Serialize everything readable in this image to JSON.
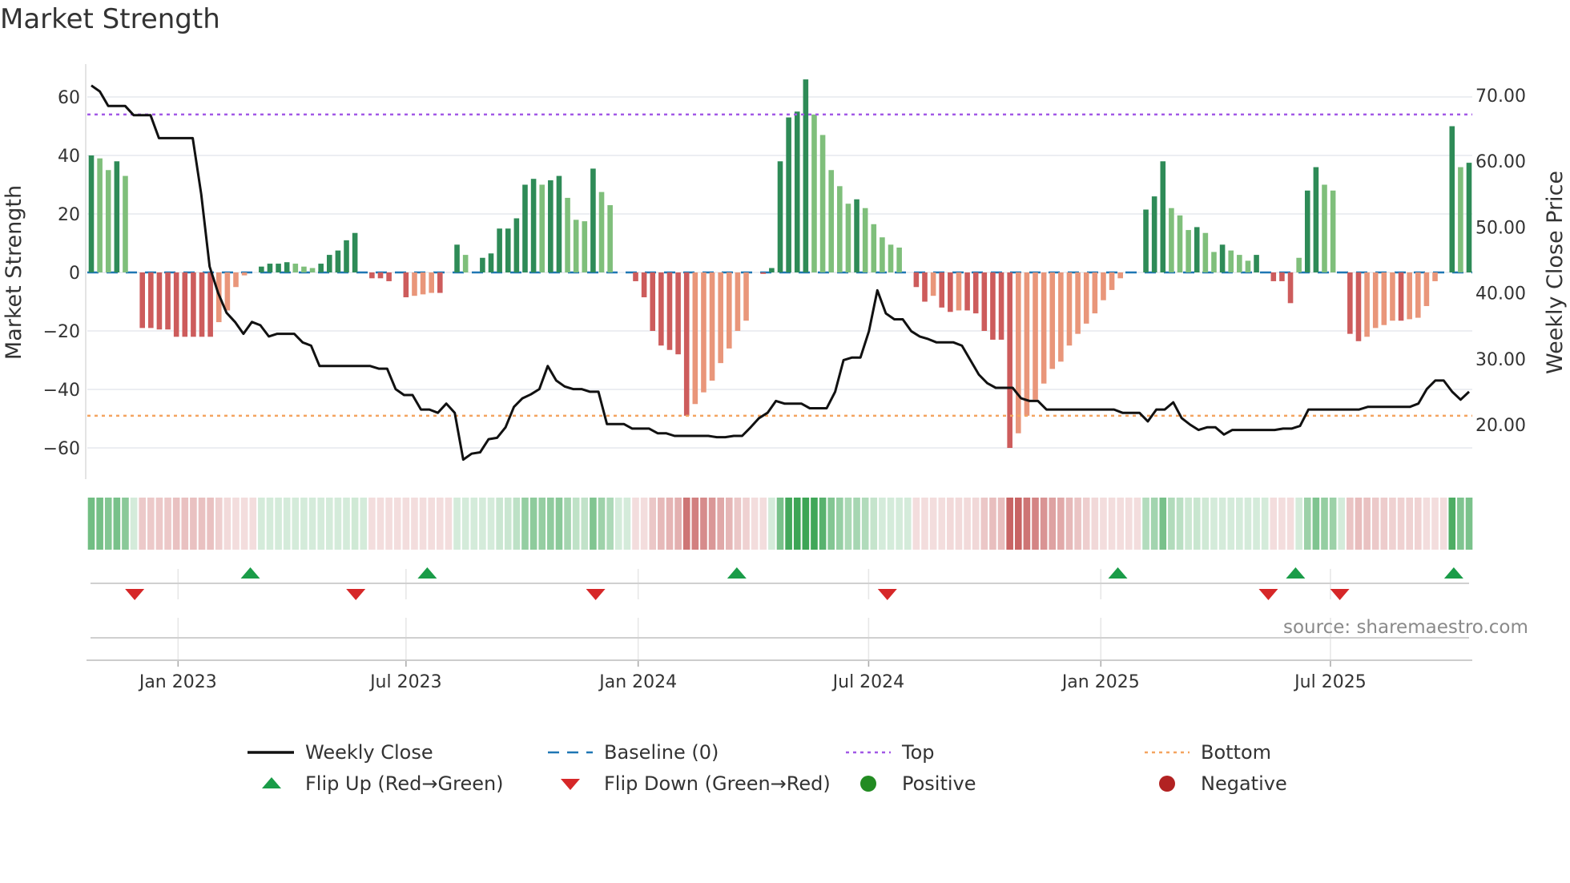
{
  "title": "Market Strength",
  "source": "source: sharemaestro.com",
  "chart_data": {
    "type": "bar",
    "title": "Market Strength",
    "ylabel": "Market Strength",
    "y2label": "Weekly Close Price",
    "ylim": [
      -72,
      70
    ],
    "y2lim": [
      14,
      72
    ],
    "yticks": [
      "60",
      "40",
      "20",
      "0",
      "−20",
      "−40",
      "−60"
    ],
    "ytick_values": [
      60,
      40,
      20,
      0,
      -20,
      -40,
      -60
    ],
    "y2ticks": [
      "70.00",
      "60.00",
      "50.00",
      "40.00",
      "30.00",
      "20.00"
    ],
    "y2tick_values": [
      70,
      60,
      50,
      40,
      30,
      20
    ],
    "top_level": 54,
    "bottom_level": -49,
    "xticks": [
      {
        "label": "Jan 2023",
        "week": 10.2
      },
      {
        "label": "Jul 2023",
        "week": 37
      },
      {
        "label": "Jan 2024",
        "week": 64.3
      },
      {
        "label": "Jul 2024",
        "week": 91.4
      },
      {
        "label": "Jan 2025",
        "week": 118.7
      },
      {
        "label": "Jul 2025",
        "week": 145.7
      }
    ],
    "strength": [
      40,
      39,
      35,
      38,
      33,
      0,
      -19,
      -19,
      -19.5,
      -19.5,
      -22,
      -22,
      -22,
      -22,
      -22,
      -17,
      -13,
      -5,
      -1,
      0,
      2,
      3,
      3,
      3.5,
      3,
      2,
      1.5,
      3,
      6,
      7.5,
      11,
      13.5,
      0,
      -2,
      -2,
      -3,
      0,
      -8.5,
      -8,
      -7.5,
      -7,
      -7,
      0,
      9.5,
      6,
      0,
      5,
      6.5,
      15,
      15,
      18.5,
      30,
      32,
      30,
      31.5,
      33,
      25.5,
      18,
      17.5,
      35.5,
      27.5,
      23,
      0,
      0,
      -3,
      -8.5,
      -20,
      -25,
      -26.5,
      -28,
      -49,
      -45,
      -41,
      -37,
      -31,
      -26,
      -20,
      -16.5,
      0,
      -0.5,
      1.5,
      38,
      53,
      55,
      66,
      54,
      47,
      35,
      29.5,
      23.5,
      25,
      22,
      16.5,
      12,
      9.5,
      8.5,
      0,
      -5,
      -10,
      -8,
      -12,
      -13.5,
      -13,
      -13,
      -14,
      -20,
      -23,
      -23,
      -60,
      -55,
      -49,
      -43.5,
      -38,
      -33,
      -30.5,
      -25,
      -21,
      -17.5,
      -14,
      -9.5,
      -6,
      -2,
      0,
      0,
      21.5,
      26,
      38,
      22,
      19.5,
      14.5,
      15.5,
      13.5,
      7,
      9.5,
      7.5,
      6,
      4,
      6,
      0,
      -3,
      -3,
      -10.5,
      5,
      28,
      36,
      30,
      28,
      0,
      -21,
      -23.5,
      -22,
      -19,
      -18,
      -16.5,
      -16.5,
      -16,
      -15.5,
      -11.5,
      -3,
      0,
      50,
      36,
      37.5
    ],
    "weekly_close": [
      71.5,
      70.6,
      68.4,
      68.4,
      68.4,
      67,
      67,
      67,
      63.5,
      63.5,
      63.5,
      63.5,
      63.5,
      55,
      44,
      40,
      37,
      35.6,
      33.8,
      35.6,
      35.1,
      33.4,
      33.8,
      33.8,
      33.8,
      32.5,
      32,
      28.9,
      28.9,
      28.9,
      28.9,
      28.9,
      28.9,
      28.9,
      28.5,
      28.5,
      25.4,
      24.5,
      24.5,
      22.3,
      22.3,
      21.8,
      23.2,
      21.8,
      14.7,
      15.6,
      15.8,
      17.8,
      18,
      19.6,
      22.7,
      24,
      24.6,
      25.4,
      28.9,
      26.7,
      25.8,
      25.4,
      25.4,
      25,
      25,
      20.1,
      20.1,
      20.1,
      19.4,
      19.4,
      19.4,
      18.7,
      18.7,
      18.3,
      18.3,
      18.3,
      18.3,
      18.3,
      18.1,
      18.1,
      18.3,
      18.3,
      19.6,
      21,
      21.8,
      23.6,
      23.2,
      23.2,
      23.2,
      22.5,
      22.5,
      22.5,
      25,
      29.8,
      30.2,
      30.2,
      34.2,
      40.4,
      36.9,
      36,
      36,
      34.2,
      33.4,
      33,
      32.5,
      32.5,
      32.5,
      32,
      29.8,
      27.6,
      26.3,
      25.6,
      25.6,
      25.6,
      24,
      23.6,
      23.6,
      22.3,
      22.3,
      22.3,
      22.3,
      22.3,
      22.3,
      22.3,
      22.3,
      22.3,
      21.8,
      21.8,
      21.8,
      20.5,
      22.3,
      22.3,
      23.4,
      21,
      20,
      19.2,
      19.6,
      19.6,
      18.5,
      19.2,
      19.2,
      19.2,
      19.2,
      19.2,
      19.2,
      19.4,
      19.4,
      19.8,
      22.3,
      22.3,
      22.3,
      22.3,
      22.3,
      22.3,
      22.3,
      22.7,
      22.7,
      22.7,
      22.7,
      22.7,
      22.7,
      23.2,
      25.4,
      26.7,
      26.7,
      25,
      23.8,
      25
    ],
    "flip_up_weeks": [
      18.7,
      39.5,
      75.9,
      120.7,
      141.6,
      160.2
    ],
    "flip_down_weeks": [
      5.1,
      31.1,
      59.3,
      93.6,
      138.4,
      146.8
    ],
    "legend": [
      {
        "label": "Weekly Close",
        "kind": "line"
      },
      {
        "label": "Baseline (0)",
        "kind": "dash"
      },
      {
        "label": "Top",
        "kind": "dot-top"
      },
      {
        "label": "Bottom",
        "kind": "dot-bottom"
      },
      {
        "label": "Flip Up (Red→Green)",
        "kind": "tri-up"
      },
      {
        "label": "Flip Down (Green→Red)",
        "kind": "tri-down"
      },
      {
        "label": "Positive",
        "kind": "dot-pos"
      },
      {
        "label": "Negative",
        "kind": "dot-neg"
      }
    ],
    "colors": {
      "pos_strong": "#2e8b57",
      "pos_weak": "#7fbf7b",
      "neg_strong": "#cd5c5c",
      "neg_weak": "#e9967a",
      "baseline": "#1f77b4",
      "top": "#a259e6",
      "bottom": "#f4a460",
      "close": "#111111",
      "flip_up": "#1a9c48",
      "flip_down": "#d62728",
      "positive": "#228b22",
      "negative": "#b22222"
    }
  }
}
